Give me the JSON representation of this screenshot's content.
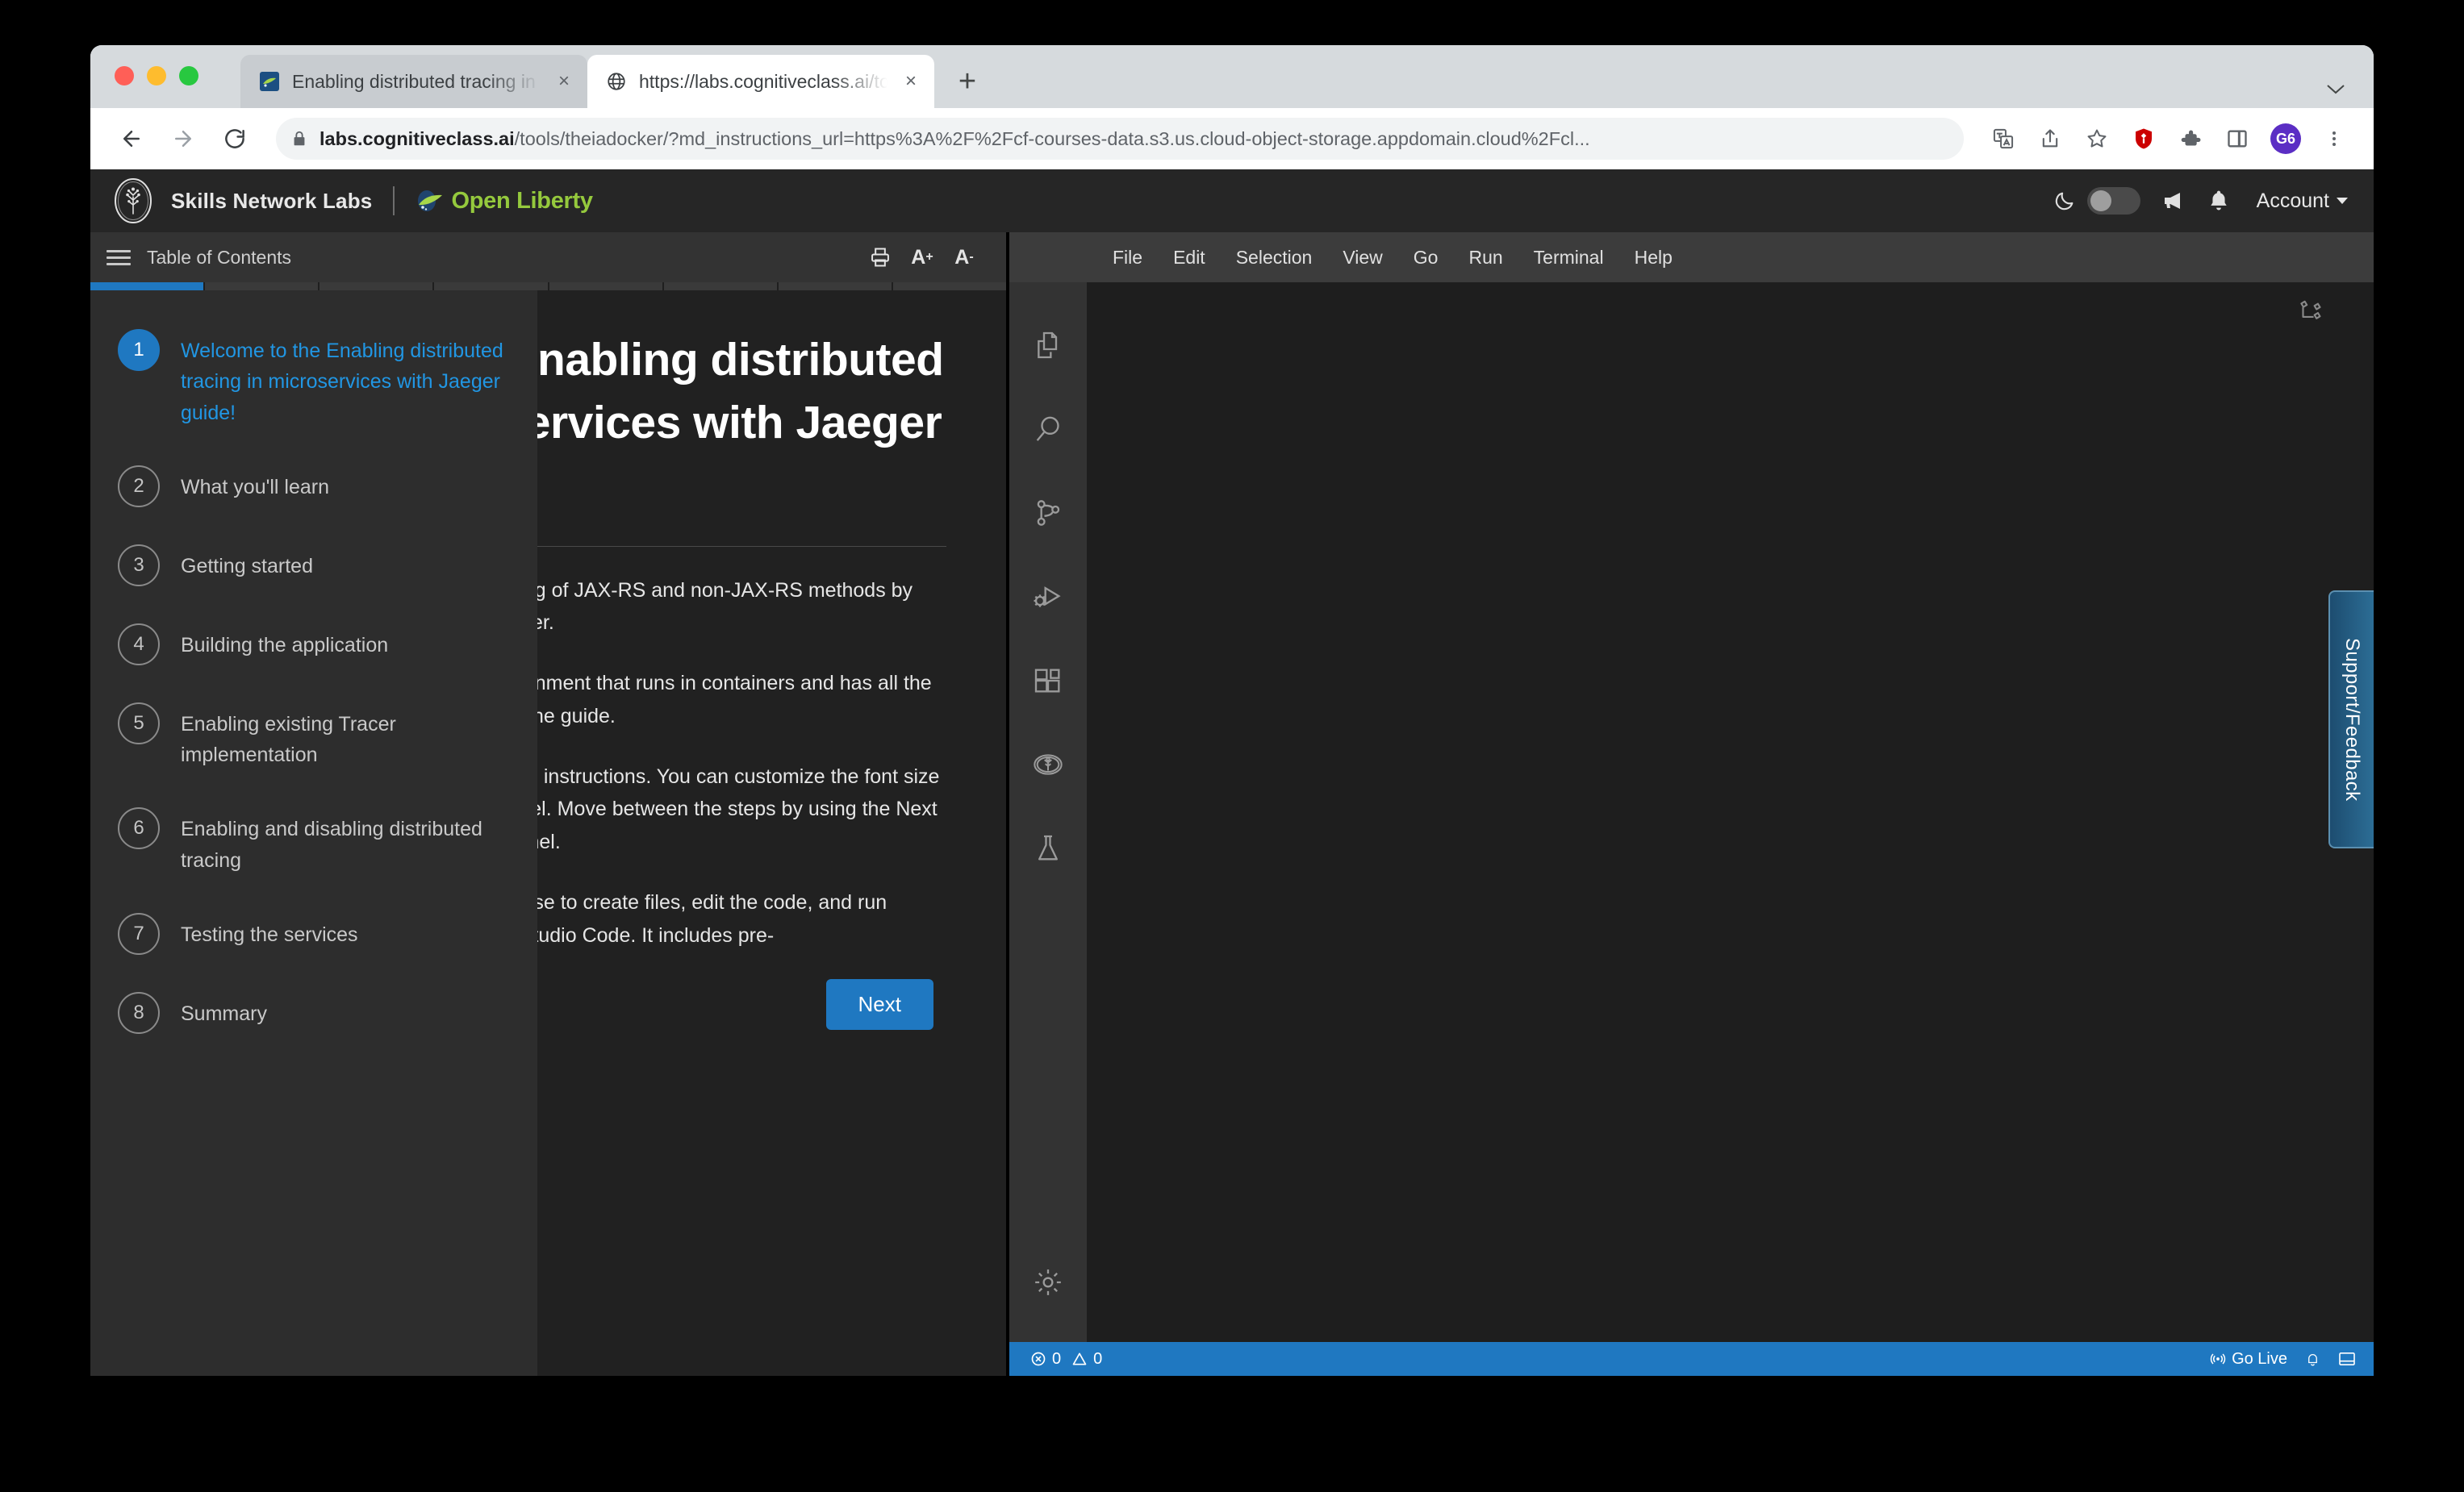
{
  "browser": {
    "tabs": [
      {
        "title": "Enabling distributed tracing in microservices with Jaeger",
        "favicon": "openliberty-favicon",
        "active": false
      },
      {
        "title": "https://labs.cognitiveclass.ai/tools/theiadocker",
        "favicon": "globe-favicon",
        "active": true
      }
    ],
    "new_tab_label": "+",
    "close_label": "×",
    "url_display": "labs.cognitiveclass.ai",
    "url_path": "/tools/theiadocker/?md_instructions_url=https%3A%2F%2Fcf-courses-data.s3.us.cloud-object-storage.appdomain.cloud%2Fcl...",
    "profile_initials": "G6"
  },
  "sn_header": {
    "title": "Skills Network Labs",
    "product": "Open Liberty",
    "account_label": "Account",
    "dark_mode_on": false
  },
  "instructions": {
    "toolbar": {
      "toc_label": "Table of Contents",
      "font_increase": "A",
      "font_increase_sup": "+",
      "font_decrease": "A",
      "font_decrease_sup": "-"
    },
    "progress": {
      "total": 8,
      "completed": 1
    },
    "toc": [
      {
        "num": "1",
        "label": "Welcome to the Enabling distributed tracing in microservices with Jaeger guide!",
        "active": true
      },
      {
        "num": "2",
        "label": "What you'll learn",
        "active": false
      },
      {
        "num": "3",
        "label": "Getting started",
        "active": false
      },
      {
        "num": "4",
        "label": "Building the application",
        "active": false
      },
      {
        "num": "5",
        "label": "Enabling existing Tracer implementation",
        "active": false
      },
      {
        "num": "6",
        "label": "Enabling and disabling distributed tracing",
        "active": false
      },
      {
        "num": "7",
        "label": "Testing the services",
        "active": false
      },
      {
        "num": "8",
        "label": "Summary",
        "active": false
      }
    ],
    "doc": {
      "title": "Welcome to the Enabling distributed tracing in microservices with Jaeger guide!",
      "p1": "Learn how to enable and customize tracing of JAX-RS and non-JAX-RS methods by using MicroProfile OpenTracing and Jaeger.",
      "p2": "This environment is a cloud-hosted environment that runs in containers and has all the tools installed that you need to complete the guide.",
      "p3": "This panel displays the step-by-step guide instructions. You can customize the font size by using the buttons at the top of this panel. Move between the steps by using the Next and Back buttons at the bottom of this panel.",
      "p4": "The panel to the right is the IDE you will use to create files, edit the code, and run commands. The IDE is based on Visual Studio Code. It includes pre-",
      "next_label": "Next"
    }
  },
  "vscode": {
    "menu": [
      "File",
      "Edit",
      "Selection",
      "View",
      "Go",
      "Run",
      "Terminal",
      "Help"
    ],
    "activity_bar": [
      "explorer-icon",
      "search-icon",
      "source-control-icon",
      "run-debug-icon",
      "extensions-icon",
      "skills-network-icon",
      "flask-icon"
    ],
    "statusbar": {
      "errors": "0",
      "warnings": "0",
      "go_live": "Go Live"
    }
  },
  "support_tab": {
    "label": "Support/Feedback"
  }
}
